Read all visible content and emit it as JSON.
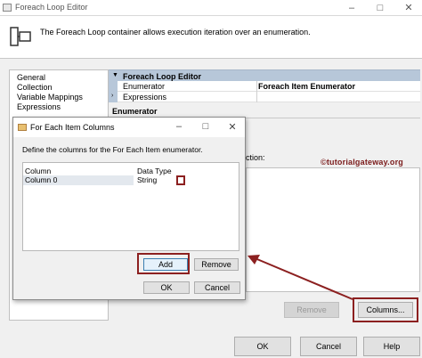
{
  "window": {
    "title": "Foreach Loop Editor"
  },
  "header": {
    "description": "The Foreach Loop container allows execution iteration over an enumeration."
  },
  "nav": {
    "items": [
      "General",
      "Collection",
      "Variable Mappings",
      "Expressions"
    ]
  },
  "properties": {
    "group_title": "Foreach Loop Editor",
    "rows": [
      {
        "name": "Enumerator",
        "value": "Foreach Item Enumerator"
      },
      {
        "name": "Expressions",
        "value": ""
      }
    ]
  },
  "enumerator": {
    "section_title": "Enumerator",
    "columns_label": "ection:",
    "watermark": "©tutorialgateway.org",
    "remove_label": "Remove",
    "columns_button_label": "Columns..."
  },
  "dialog": {
    "title": "For Each Item Columns",
    "description": "Define the columns for the For Each Item enumerator.",
    "grid": {
      "headers": [
        "Column",
        "Data Type"
      ],
      "rows": [
        {
          "column": "Column 0",
          "data_type": "String"
        }
      ]
    },
    "add_label": "Add",
    "remove_label": "Remove",
    "ok_label": "OK",
    "cancel_label": "Cancel"
  },
  "footer": {
    "ok_label": "OK",
    "cancel_label": "Cancel",
    "help_label": "Help"
  },
  "colors": {
    "highlight": "#8c2020",
    "property_header": "#b7c7d9"
  }
}
